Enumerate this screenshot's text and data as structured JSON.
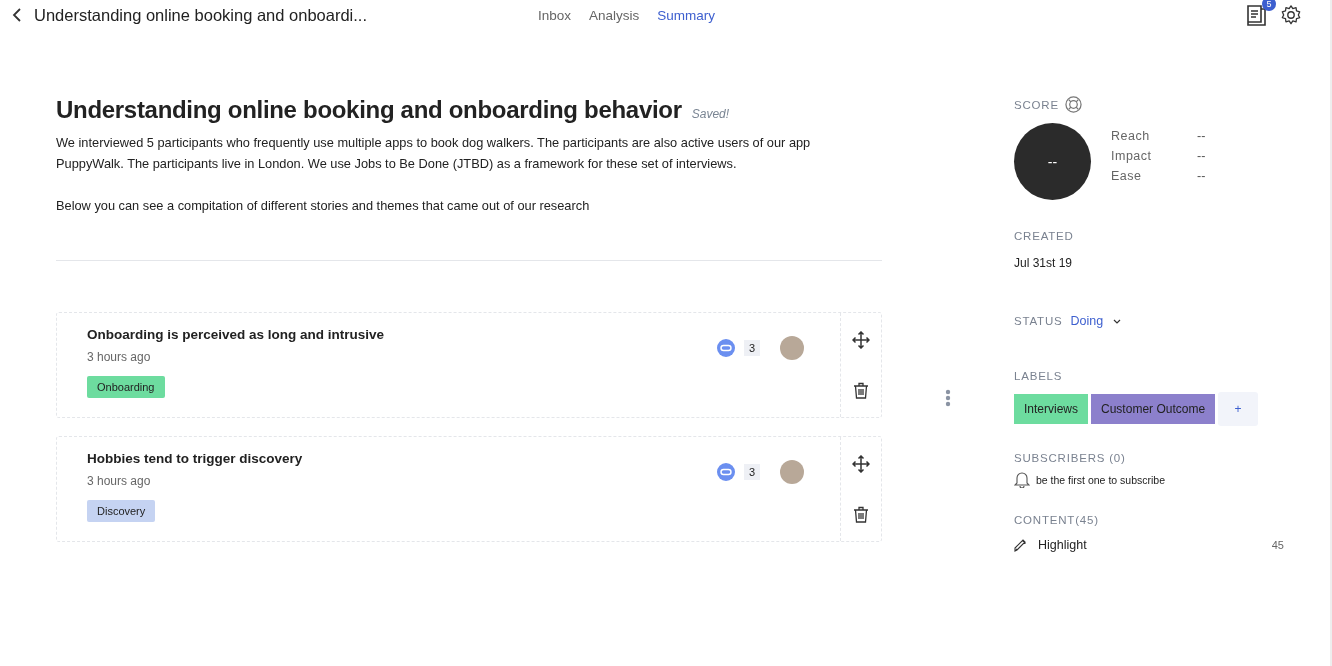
{
  "header": {
    "title": "Understanding online booking and onboardi...",
    "notification_count": "5"
  },
  "tabs": [
    {
      "label": "Inbox",
      "selected": false
    },
    {
      "label": "Analysis",
      "selected": false
    },
    {
      "label": "Summary",
      "selected": true
    }
  ],
  "page": {
    "title": "Understanding online booking and onboarding behavior",
    "save_status": "Saved!",
    "description_lines": [
      "We interviewed 5 participants who frequently use multiple apps to book dog walkers. The participants are also active users of our app",
      "PuppyWalk. The participants live in  London. We use Jobs to Be Done (JTBD) as a framework for these set of interviews."
    ],
    "note": "Below you can see a compitation of different stories and themes that came out of our research"
  },
  "insights": [
    {
      "title": "Onboarding is perceived as long and intrusive",
      "time": "3 hours ago",
      "tag": {
        "label": "Onboarding",
        "color": "#6ddc9f"
      },
      "comments": "3"
    },
    {
      "title": "Hobbies tend to trigger discovery",
      "time": "3 hours ago",
      "tag": {
        "label": "Discovery",
        "color": "#c5d3f2"
      },
      "comments": "3"
    }
  ],
  "sidebar": {
    "score_heading": "SCORE",
    "score_value": "--",
    "metrics": [
      {
        "label": "Reach",
        "value": "--"
      },
      {
        "label": "Impact",
        "value": "--"
      },
      {
        "label": "Ease",
        "value": "--"
      }
    ],
    "created_heading": "CREATED",
    "created": "Jul 31st 19",
    "status_heading": "STATUS",
    "status": "Doing",
    "labels_heading": "LABELS",
    "labels": [
      {
        "label": "Interviews",
        "color": "#6ddc9f"
      },
      {
        "label": "Customer Outcome",
        "color": "#8c80cc"
      }
    ],
    "add_label": "+",
    "subscribers_heading": "SUBSCRIBERS (0)",
    "subscribe_hint": "be the first one to subscribe",
    "content_heading": "CONTENT(45)",
    "content": [
      {
        "label": "Highlight",
        "count": "45"
      }
    ]
  }
}
